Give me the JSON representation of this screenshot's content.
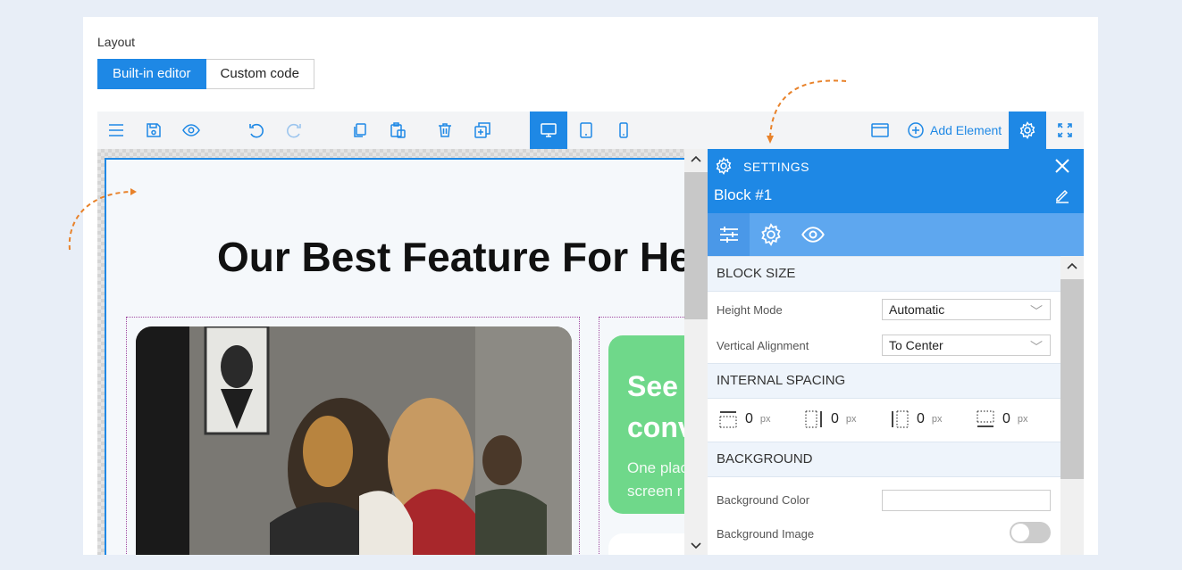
{
  "layout": {
    "label": "Layout",
    "modes": [
      "Built-in editor",
      "Custom code"
    ],
    "active_mode": "Built-in editor"
  },
  "toolbar": {
    "add_element_label": "Add Element"
  },
  "canvas": {
    "headline": "Our Best Feature For He",
    "feature_card": {
      "title_line1": "See",
      "title_line2": "conv",
      "desc_line1": "One plac",
      "desc_line2": "screen r"
    }
  },
  "settings": {
    "title": "SETTINGS",
    "block_name": "Block #1",
    "sections": {
      "block_size": "BLOCK SIZE",
      "internal_spacing": "INTERNAL SPACING",
      "background": "BACKGROUND"
    },
    "height_mode": {
      "label": "Height Mode",
      "value": "Automatic"
    },
    "vertical_alignment": {
      "label": "Vertical Alignment",
      "value": "To Center"
    },
    "spacing": {
      "top": "0",
      "right": "0",
      "left": "0",
      "bottom": "0",
      "unit": "px"
    },
    "background_color": {
      "label": "Background Color",
      "value": ""
    },
    "background_image": {
      "label": "Background Image",
      "enabled": false
    }
  },
  "colors": {
    "accent": "#1e88e5",
    "feature_card": "#6fd88a",
    "arrow": "#e8822a"
  }
}
